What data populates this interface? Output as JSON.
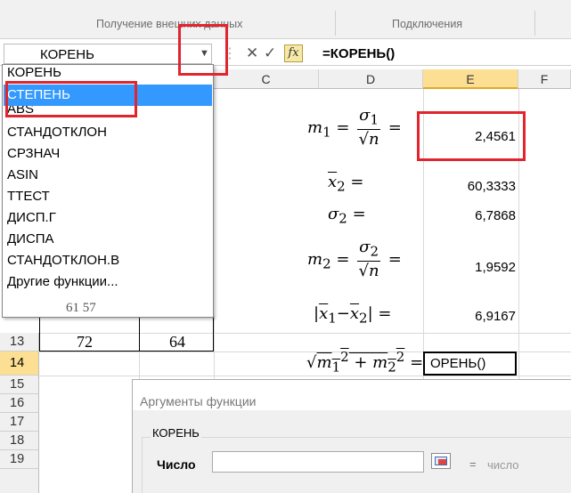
{
  "ribbon": {
    "group_external_data": "Получение внешних данных",
    "group_connections": "Подключения"
  },
  "formula_bar": {
    "name_box_value": "КОРЕНЬ",
    "formula": "=КОРЕНЬ()"
  },
  "columns": [
    "C",
    "D",
    "E",
    "F"
  ],
  "rows": [
    "13",
    "14",
    "15",
    "16",
    "17",
    "18",
    "19"
  ],
  "cells": {
    "A13": "72",
    "B13": "64",
    "E14_edit": "ОРЕНЬ()"
  },
  "math_labels": {
    "m1": "m₁ = σ₁/√n =",
    "x2": "x̄₂ =",
    "s2": "σ₂ =",
    "m2": "m₂ = σ₂/√n =",
    "diff": "|x̄₁−x̄₂| =",
    "sqrt": "√(m₁² + m₂²) ="
  },
  "values_E": {
    "m1": "2,4561",
    "x2": "60,3333",
    "s2": "6,7868",
    "m2": "1,9592",
    "diff": "6,9167"
  },
  "function_dropdown": {
    "items": [
      "КОРЕНЬ",
      "СТЕПЕНЬ",
      "ABS",
      "СТАНДОТКЛОН",
      "СРЗНАЧ",
      "ASIN",
      "ТТЕСТ",
      "ДИСП.Г",
      "ДИСПА",
      "СТАНДОТКЛОН.В",
      "Другие функции..."
    ],
    "selected_index": 1,
    "partial_last_row": "61   57"
  },
  "dialog": {
    "title": "Аргументы функции",
    "group_label": "КОРЕНЬ",
    "arg_label": "Число",
    "arg_value": "",
    "equals": "=",
    "result_hint": "число"
  },
  "colors": {
    "annotation_red": "#e0252e",
    "selection_blue": "#3399ff",
    "header_selected": "#fcdf92"
  }
}
